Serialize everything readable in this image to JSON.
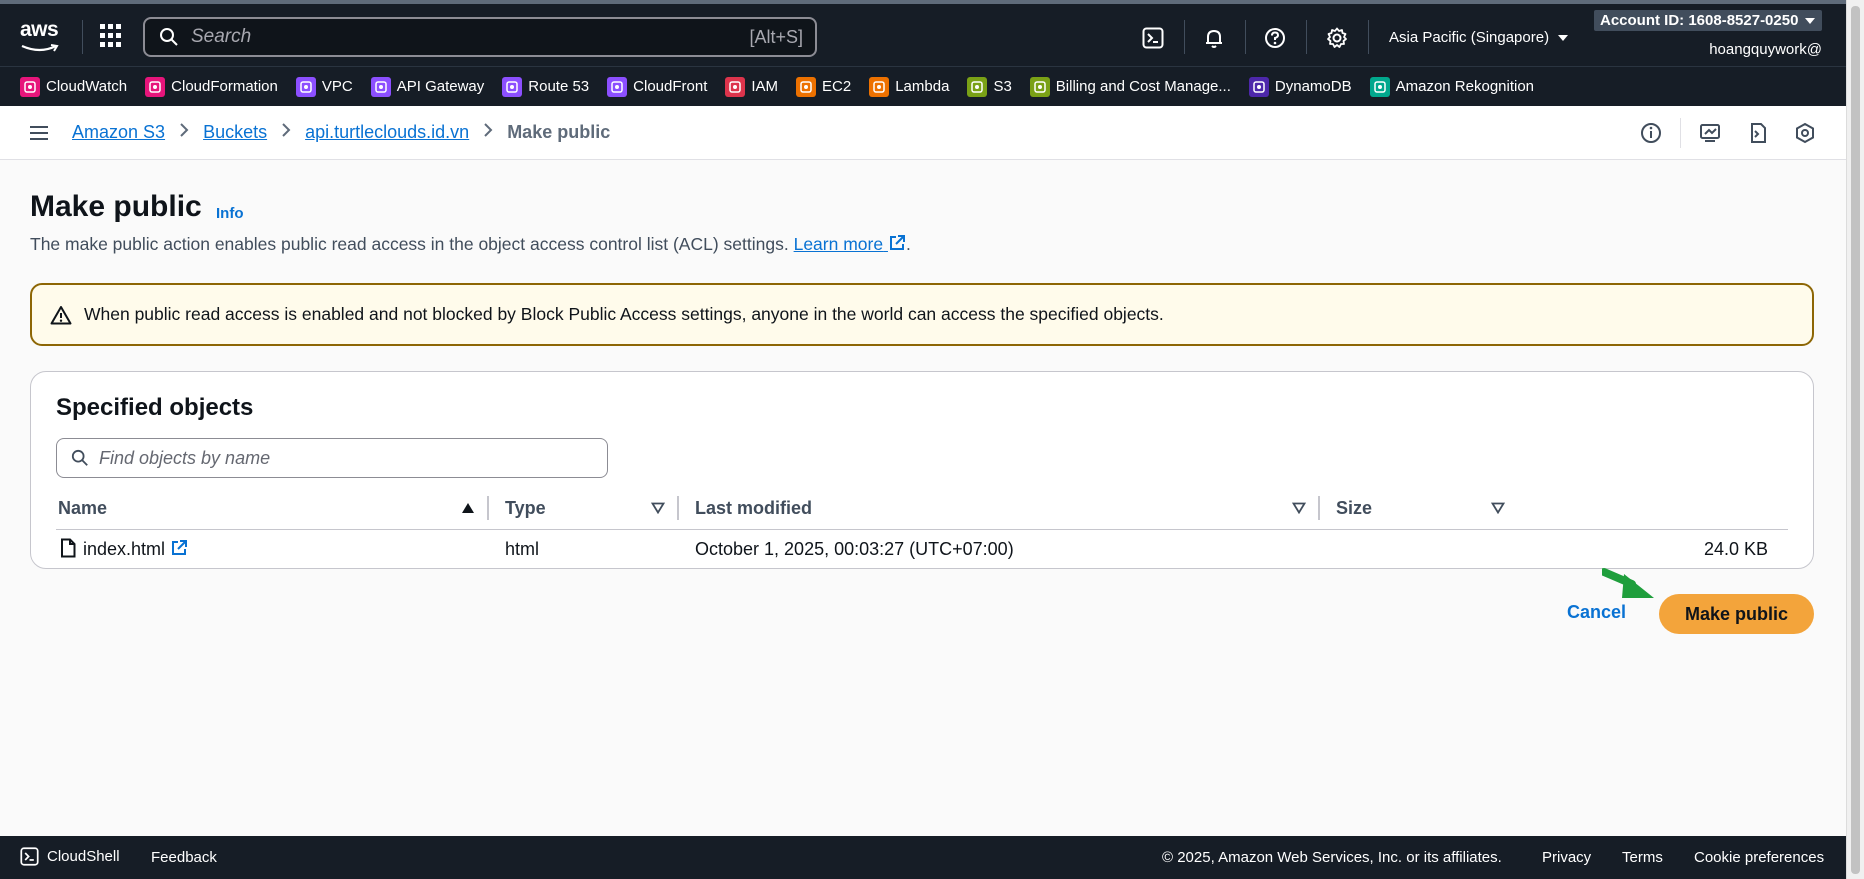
{
  "topbar": {
    "logo_text": "aws",
    "search_placeholder": "Search",
    "search_shortcut": "[Alt+S]",
    "region": "Asia Pacific (Singapore)",
    "account_id": "Account ID: 1608-8527-0250",
    "username": "hoangquywork@"
  },
  "favorites": [
    {
      "label": "CloudWatch",
      "color": "#e7157b",
      "icon": "cloudwatch-icon"
    },
    {
      "label": "CloudFormation",
      "color": "#e7157b",
      "icon": "cloudformation-icon"
    },
    {
      "label": "VPC",
      "color": "#8c4fff",
      "icon": "vpc-icon"
    },
    {
      "label": "API Gateway",
      "color": "#8c4fff",
      "icon": "api-gateway-icon"
    },
    {
      "label": "Route 53",
      "color": "#8c4fff",
      "icon": "route53-icon"
    },
    {
      "label": "CloudFront",
      "color": "#8c4fff",
      "icon": "cloudfront-icon"
    },
    {
      "label": "IAM",
      "color": "#dd344c",
      "icon": "iam-icon"
    },
    {
      "label": "EC2",
      "color": "#ed7100",
      "icon": "ec2-icon"
    },
    {
      "label": "Lambda",
      "color": "#ed7100",
      "icon": "lambda-icon"
    },
    {
      "label": "S3",
      "color": "#7aa116",
      "icon": "s3-icon"
    },
    {
      "label": "Billing and Cost Manage...",
      "color": "#7aa116",
      "icon": "billing-icon"
    },
    {
      "label": "DynamoDB",
      "color": "#4d27aa",
      "icon": "dynamodb-icon"
    },
    {
      "label": "Amazon Rekognition",
      "color": "#01a88d",
      "icon": "rekognition-icon"
    }
  ],
  "breadcrumb": {
    "items": [
      "Amazon S3",
      "Buckets",
      "api.turtleclouds.id.vn"
    ],
    "current": "Make public"
  },
  "page": {
    "title": "Make public",
    "info": "Info",
    "description": "The make public action enables public read access in the object access control list (ACL) settings.",
    "learn_more": "Learn more",
    "period": "."
  },
  "alert": {
    "text": "When public read access is enabled and not blocked by Block Public Access settings, anyone in the world can access the specified objects."
  },
  "objects": {
    "title": "Specified objects",
    "filter_placeholder": "Find objects by name",
    "columns": [
      "Name",
      "Type",
      "Last modified",
      "Size"
    ],
    "rows": [
      {
        "name": "index.html",
        "type": "html",
        "modified": "October 1, 2025, 00:03:27 (UTC+07:00)",
        "size": "24.0 KB"
      }
    ]
  },
  "actions": {
    "cancel": "Cancel",
    "primary": "Make public"
  },
  "footer": {
    "cloudshell": "CloudShell",
    "feedback": "Feedback",
    "copyright": "© 2025, Amazon Web Services, Inc. or its affiliates.",
    "privacy": "Privacy",
    "terms": "Terms",
    "cookies": "Cookie preferences"
  },
  "colors": {
    "primary_button": "#f3a43b",
    "link": "#0972d3",
    "alert_border": "#8d6605",
    "annotation_arrow": "#1f9e3c"
  }
}
